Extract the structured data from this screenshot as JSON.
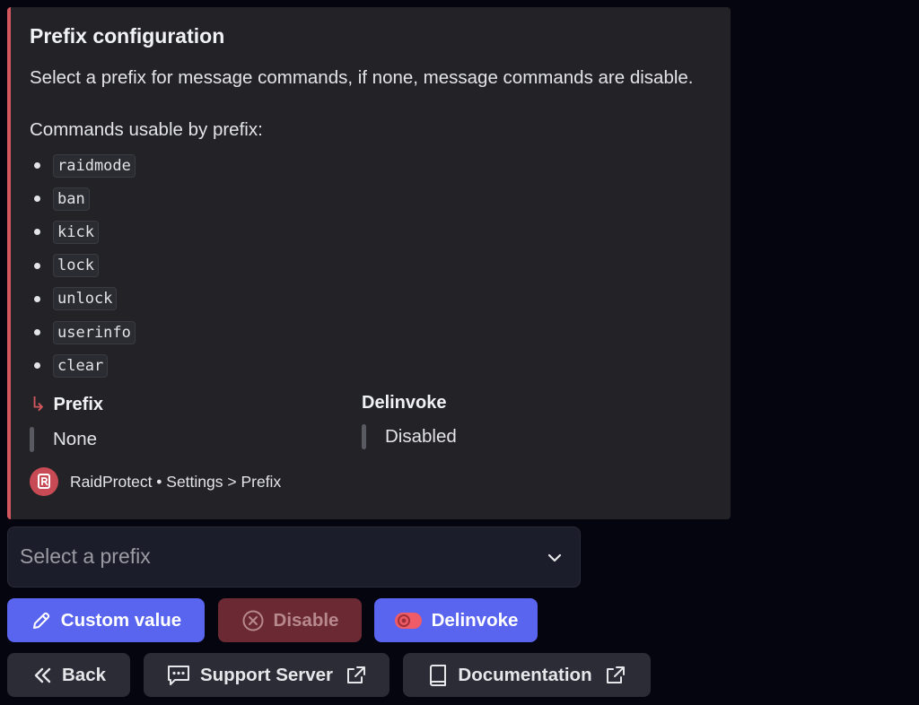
{
  "embed": {
    "accent_color": "#d2565d",
    "title": "Prefix configuration",
    "description": "Select a prefix for message commands, if none, message commands are disable.",
    "commands_heading": "Commands usable by prefix:",
    "commands": [
      "raidmode",
      "ban",
      "kick",
      "lock",
      "unlock",
      "userinfo",
      "clear"
    ],
    "fields": [
      {
        "name": "Prefix",
        "value": "None",
        "icon": "reply-arrow-icon"
      },
      {
        "name": "Delinvoke",
        "value": "Disabled"
      }
    ],
    "footer": {
      "text": "RaidProtect • Settings > Prefix",
      "icon": "raidprotect-logo"
    }
  },
  "select_menu": {
    "placeholder": "Select a prefix",
    "icon": "chevron-down-icon"
  },
  "buttons": {
    "custom_value": {
      "label": "Custom value",
      "icon": "pencil-icon",
      "color": "#5964ef"
    },
    "disable": {
      "label": "Disable",
      "icon": "circle-x-icon",
      "state": "disabled",
      "color": "#6b2a33"
    },
    "delinvoke": {
      "label": "Delinvoke",
      "icon": "toggle-off-icon",
      "color": "#5964ef"
    },
    "back": {
      "label": "Back",
      "icon": "double-chevron-left-icon"
    },
    "support_server": {
      "label": "Support Server",
      "icon": "chat-bubble-icon",
      "external_icon": "external-link-icon"
    },
    "documentation": {
      "label": "Documentation",
      "icon": "book-icon",
      "external_icon": "external-link-icon"
    }
  }
}
